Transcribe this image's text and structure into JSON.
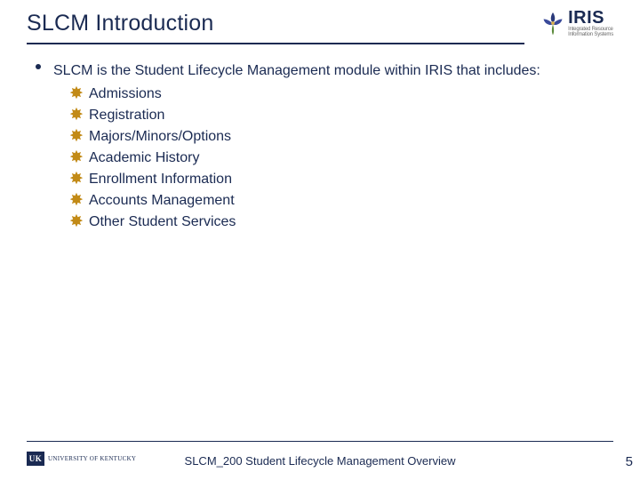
{
  "header": {
    "title": "SLCM Introduction",
    "iris_word": "IRIS",
    "iris_sub1": "Integrated Resource",
    "iris_sub2": "Information Systems"
  },
  "body": {
    "lead": "SLCM is the Student Lifecycle Management module within IRIS that includes:",
    "items": [
      "Admissions",
      "Registration",
      "Majors/Minors/Options",
      "Academic History",
      "Enrollment Information",
      "Accounts Management",
      "Other Student Services"
    ]
  },
  "footer": {
    "uk_mark": "UK",
    "uk_word": "UNIVERSITY OF KENTUCKY",
    "course": "SLCM_200 Student Lifecycle Management Overview",
    "page": "5"
  }
}
